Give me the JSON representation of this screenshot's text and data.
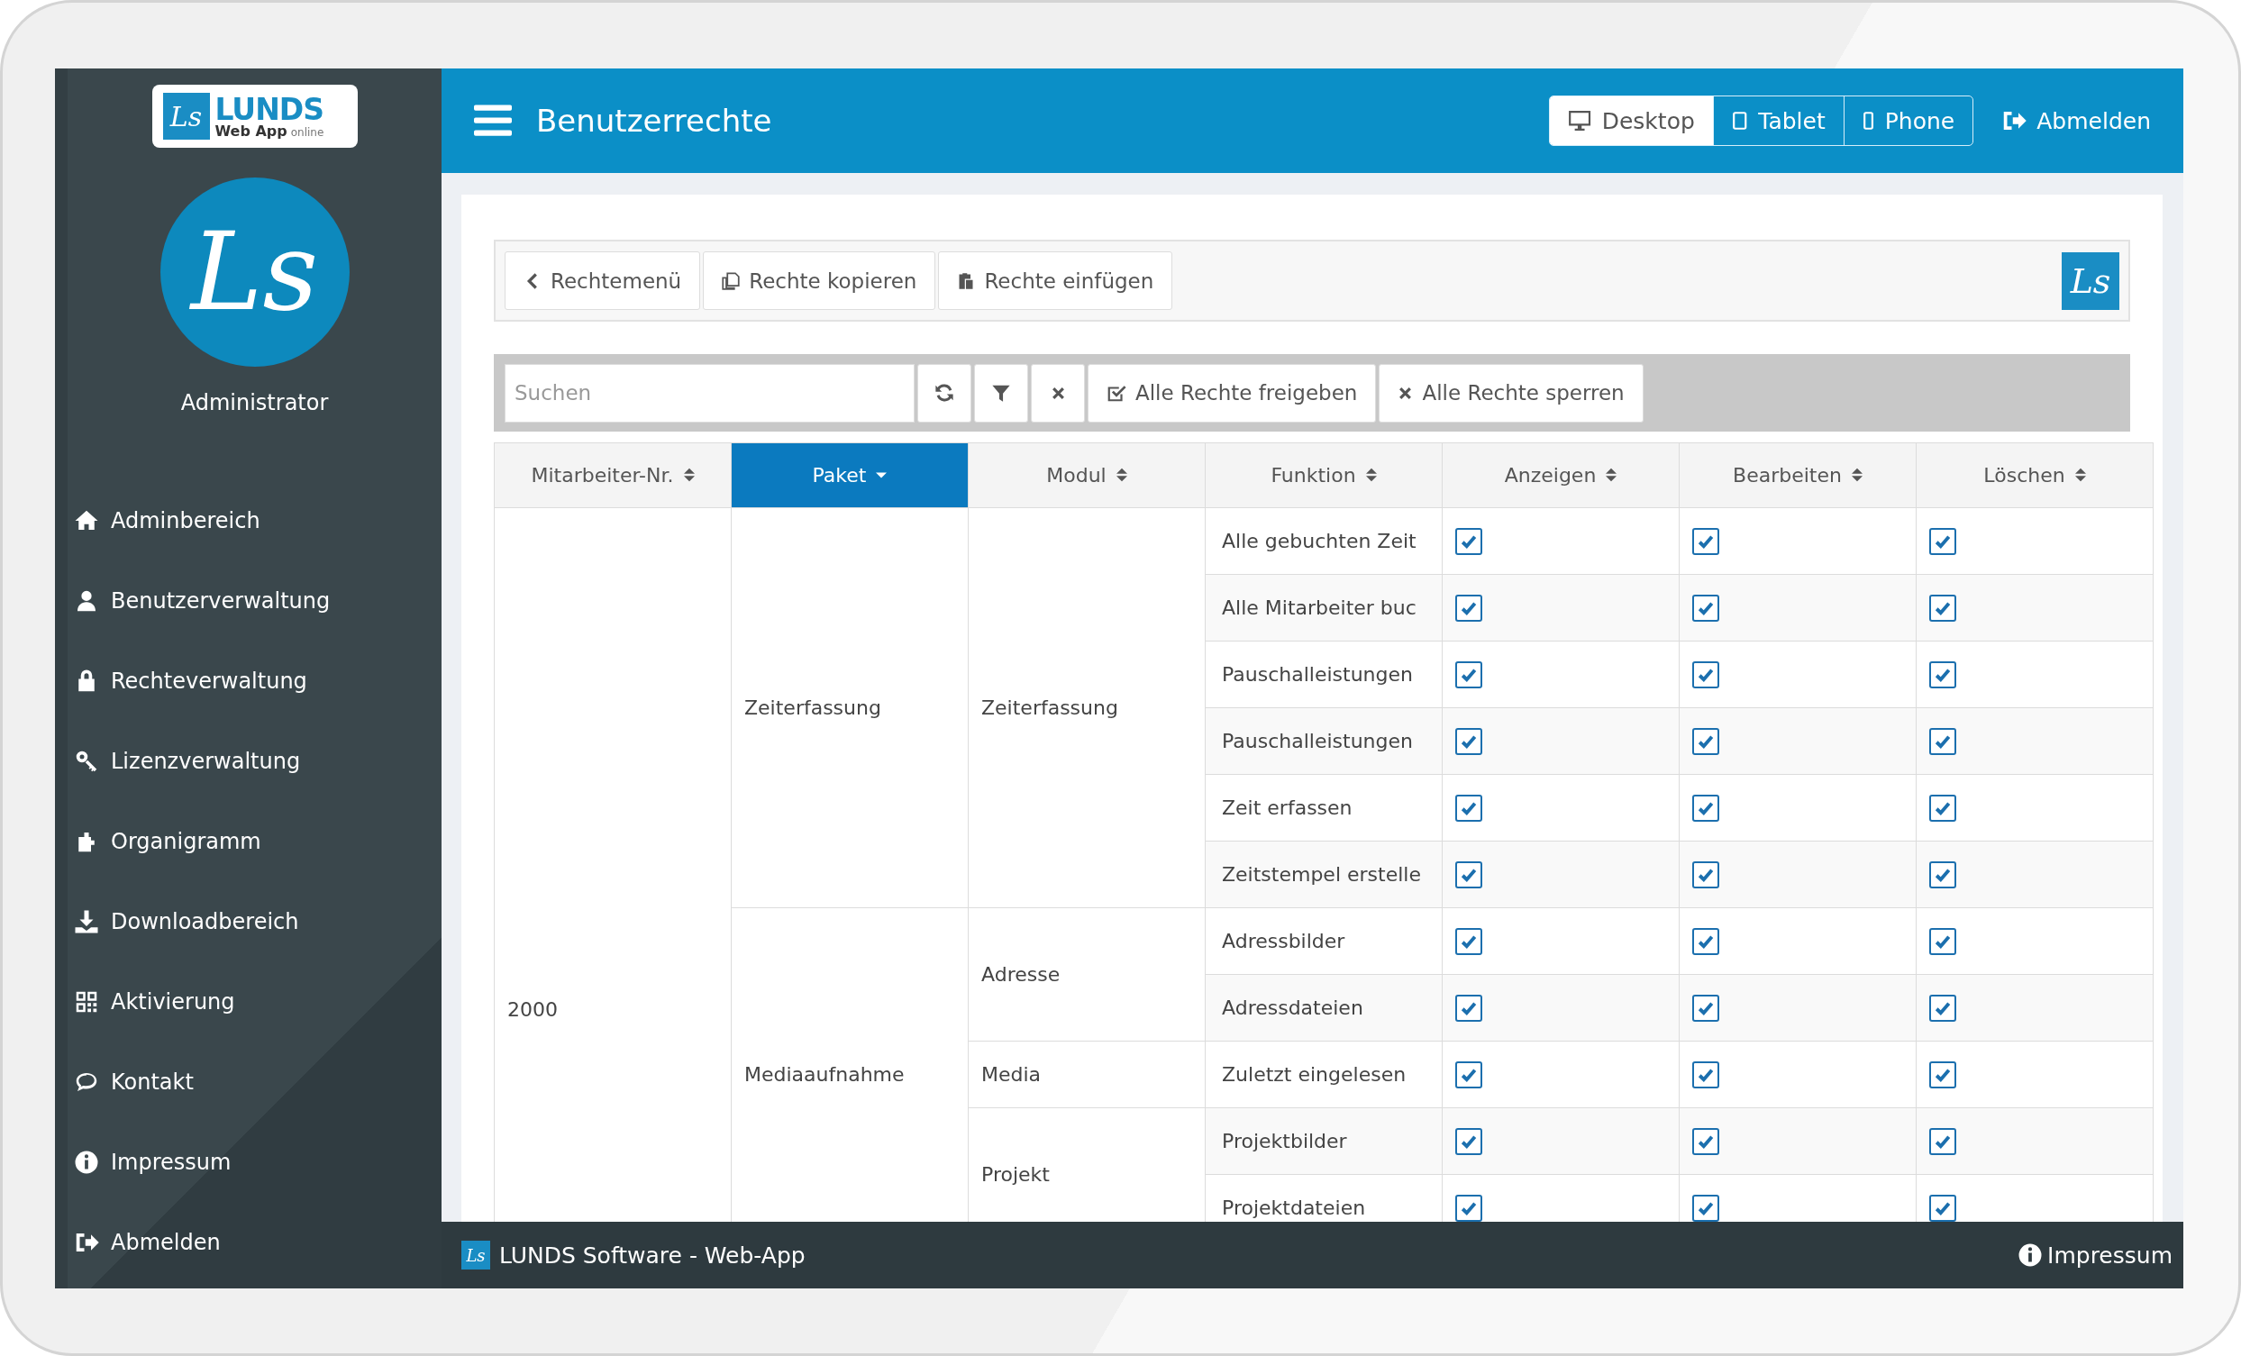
{
  "sidebar": {
    "logo": {
      "mark": "Ls",
      "name": "LUNDS",
      "subtitle": "Web App",
      "tag": "online"
    },
    "avatar_mark": "Ls",
    "user": "Administrator",
    "items": [
      {
        "label": "Adminbereich"
      },
      {
        "label": "Benutzerverwaltung"
      },
      {
        "label": "Rechteverwaltung"
      },
      {
        "label": "Lizenzverwaltung"
      },
      {
        "label": "Organigramm"
      },
      {
        "label": "Downloadbereich"
      },
      {
        "label": "Aktivierung"
      },
      {
        "label": "Kontakt"
      },
      {
        "label": "Impressum"
      },
      {
        "label": "Abmelden"
      }
    ]
  },
  "header": {
    "title": "Benutzerrechte",
    "view_modes": [
      {
        "label": "Desktop",
        "selected": true
      },
      {
        "label": "Tablet",
        "selected": false
      },
      {
        "label": "Phone",
        "selected": false
      }
    ],
    "logout": "Abmelden"
  },
  "toolbar": {
    "buttons": [
      "Rechtemenü",
      "Rechte kopieren",
      "Rechte einfügen"
    ],
    "logo_mark": "Ls"
  },
  "filter_bar": {
    "search": {
      "placeholder": "Suchen"
    },
    "actions": [
      "Alle Rechte freigeben",
      "Alle Rechte sperren"
    ]
  },
  "table": {
    "columns": [
      {
        "label": "Mitarbeiter-Nr.",
        "selected": false
      },
      {
        "label": "Paket",
        "selected": true
      },
      {
        "label": "Modul",
        "selected": false
      },
      {
        "label": "Funktion",
        "selected": false
      },
      {
        "label": "Anzeigen",
        "selected": false
      },
      {
        "label": "Bearbeiten",
        "selected": false
      },
      {
        "label": "Löschen",
        "selected": false
      }
    ],
    "employees": [
      {
        "nr": "2000",
        "packages": [
          {
            "name": "Zeiterfassung",
            "modules": [
              {
                "name": "Zeiterfassung",
                "functions": [
                  {
                    "name": "Alle gebuchten Zeit",
                    "view": true,
                    "edit": true,
                    "delete": true
                  },
                  {
                    "name": "Alle Mitarbeiter buc",
                    "view": true,
                    "edit": true,
                    "delete": true
                  },
                  {
                    "name": "Pauschalleistungen",
                    "view": true,
                    "edit": true,
                    "delete": true
                  },
                  {
                    "name": "Pauschalleistungen",
                    "view": true,
                    "edit": true,
                    "delete": true
                  },
                  {
                    "name": "Zeit erfassen",
                    "view": true,
                    "edit": true,
                    "delete": true
                  },
                  {
                    "name": "Zeitstempel erstelle",
                    "view": true,
                    "edit": true,
                    "delete": true
                  }
                ]
              }
            ]
          },
          {
            "name": "Mediaaufnahme",
            "modules": [
              {
                "name": "Adresse",
                "functions": [
                  {
                    "name": "Adressbilder",
                    "view": true,
                    "edit": true,
                    "delete": true
                  },
                  {
                    "name": "Adressdateien",
                    "view": true,
                    "edit": true,
                    "delete": true
                  }
                ]
              },
              {
                "name": "Media",
                "functions": [
                  {
                    "name": "Zuletzt eingelesen",
                    "view": true,
                    "edit": true,
                    "delete": true
                  }
                ]
              },
              {
                "name": "Projekt",
                "functions": [
                  {
                    "name": "Projektbilder",
                    "view": true,
                    "edit": true,
                    "delete": true
                  },
                  {
                    "name": "Projektdateien",
                    "view": true,
                    "edit": true,
                    "delete": true
                  }
                ]
              }
            ]
          }
        ]
      }
    ]
  },
  "footer": {
    "logo_mark": "Ls",
    "text": "LUNDS Software - Web-App",
    "impressum": "Impressum"
  }
}
